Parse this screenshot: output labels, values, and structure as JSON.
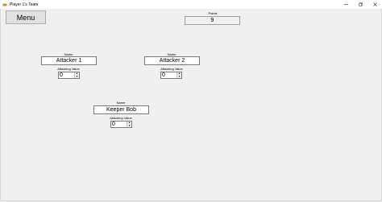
{
  "window": {
    "title": "Player 1's Team"
  },
  "menu_label": "Menu",
  "points": {
    "label": "Points",
    "value": "9"
  },
  "attacker1": {
    "name_label": "Name",
    "name": "Attacker 1",
    "value_label": "Attacking Value",
    "value": "0"
  },
  "attacker2": {
    "name_label": "Name",
    "name": "Attacker 2",
    "value_label": "Attacking Value",
    "value": "0"
  },
  "keeper": {
    "name_label": "Name",
    "name": "Keeper Bob",
    "value_label": "Attacking Value",
    "value": "0"
  },
  "icons": {
    "app": "game-controller-icon",
    "minimize": "minimize-icon",
    "maximize": "maximize-icon",
    "close": "close-icon"
  }
}
